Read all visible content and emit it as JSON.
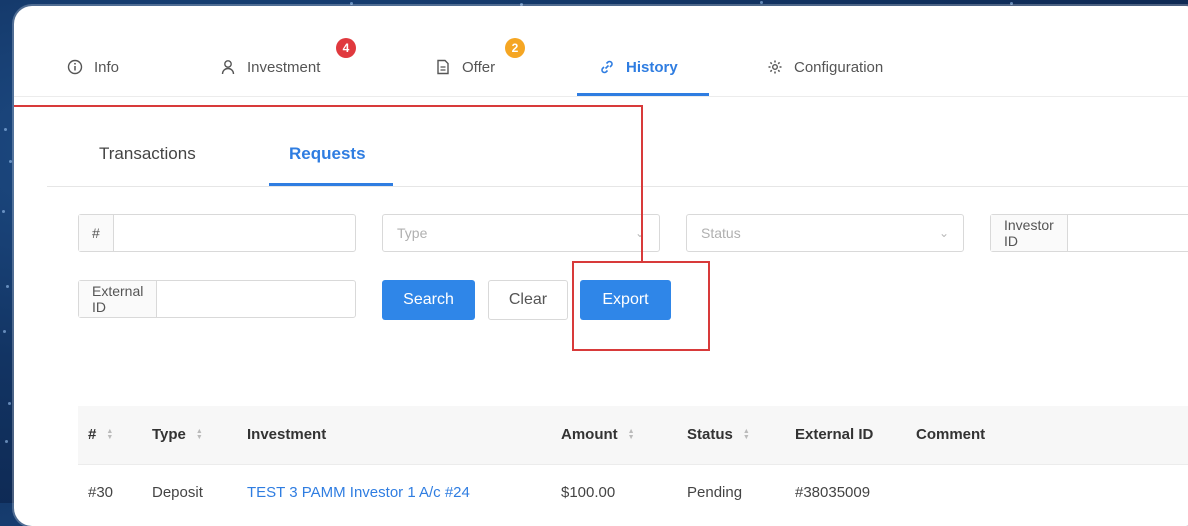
{
  "main_tabs": [
    {
      "label": "Info",
      "icon": "info-icon"
    },
    {
      "label": "Investment",
      "icon": "user-icon",
      "badge": "4",
      "badge_color": "#e0393e"
    },
    {
      "label": "Offer",
      "icon": "document-icon",
      "badge": "2",
      "badge_color": "#f5a623"
    },
    {
      "label": "History",
      "icon": "link-icon",
      "active": true
    },
    {
      "label": "Configuration",
      "icon": "gear-icon"
    }
  ],
  "sub_tabs": [
    {
      "label": "Transactions"
    },
    {
      "label": "Requests",
      "active": true
    }
  ],
  "filters": {
    "id_addon": "#",
    "id_value": "",
    "type_placeholder": "Type",
    "status_placeholder": "Status",
    "investor_id_addon": "Investor ID",
    "investor_id_value": "",
    "external_id_addon": "External ID",
    "external_id_value": ""
  },
  "buttons": {
    "search": "Search",
    "clear": "Clear",
    "export": "Export"
  },
  "table": {
    "columns": [
      "#",
      "Type",
      "Investment",
      "Amount",
      "Status",
      "External ID",
      "Comment"
    ],
    "rows": [
      {
        "id": "#30",
        "type": "Deposit",
        "investment": "TEST 3 PAMM Investor 1 A/c #24",
        "amount": "$100.00",
        "status": "Pending",
        "external_id": "#38035009",
        "comment": ""
      }
    ]
  },
  "colors": {
    "accent": "#2f7de1",
    "annotation": "#d83a3a",
    "background": "#123463"
  }
}
